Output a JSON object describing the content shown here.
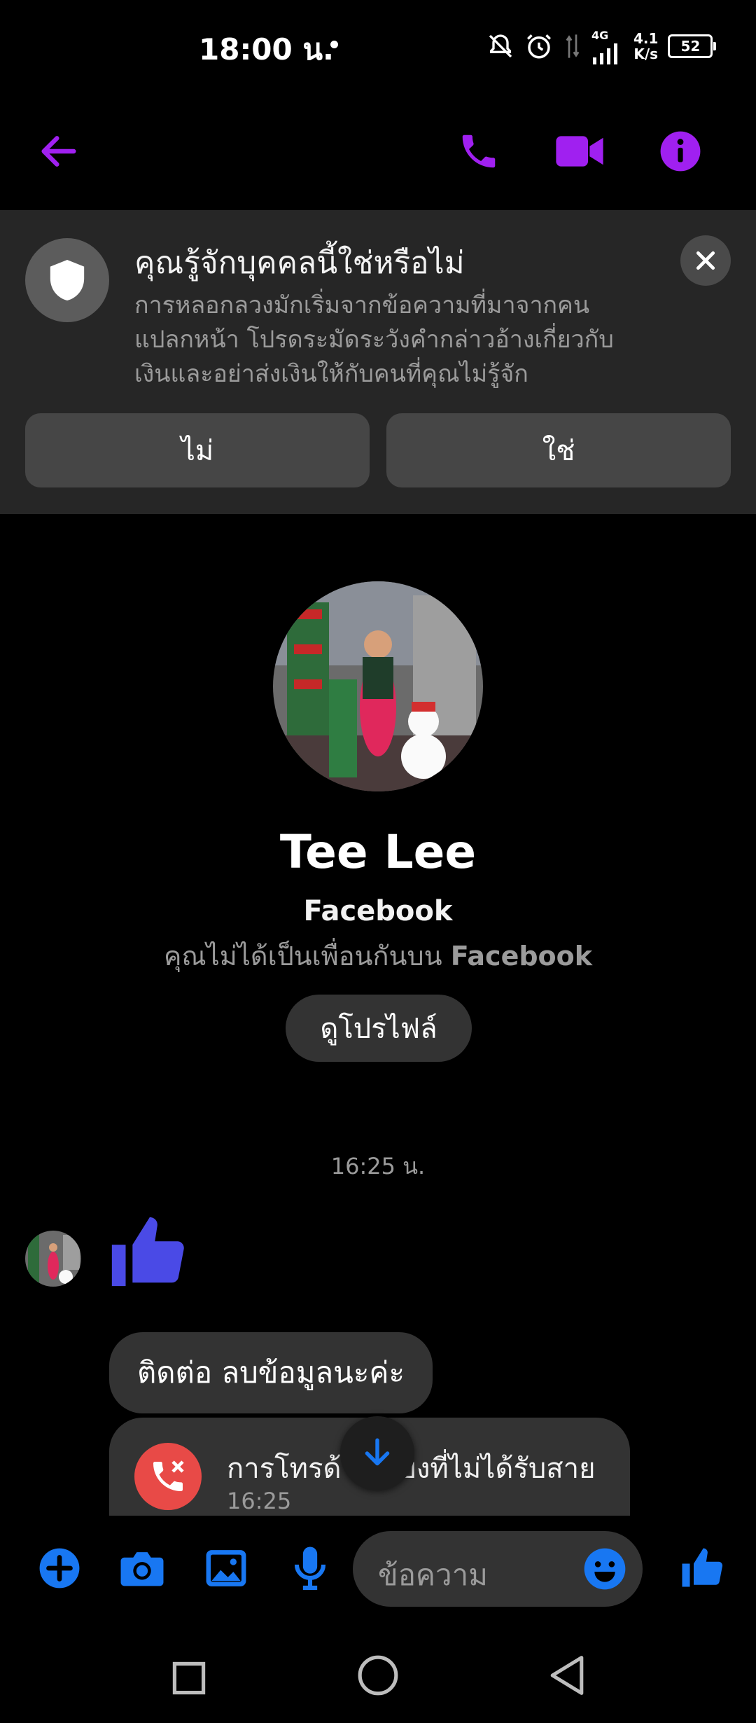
{
  "status_bar": {
    "time": "18:00 น.",
    "network_type": "4G",
    "speed_value": "4.1",
    "speed_unit": "K/s",
    "battery": "52"
  },
  "top_bar": {
    "back_icon": "arrow-left-icon",
    "call_icon": "phone-icon",
    "video_icon": "video-camera-icon",
    "info_icon": "info-icon",
    "accent_color": "#a020f0"
  },
  "warning": {
    "title": "คุณรู้จักบุคคลนี้ใช่หรือไม่",
    "body_line1": "การหลอกลวงมักเริ่มจากข้อความที่มาจากคน",
    "body_line2": "แปลกหน้า โปรดระมัดระวังคำกล่าวอ้างเกี่ยวกับ",
    "body_line3": "เงินและอย่าส่งเงินให้กับคนที่คุณไม่รู้จัก",
    "no_label": "ไม่",
    "yes_label": "ใช่"
  },
  "profile": {
    "name": "Tee Lee",
    "platform": "Facebook",
    "relation_prefix": "คุณไม่ได้เป็นเพื่อนกันบน",
    "relation_platform": "Facebook",
    "view_profile_label": "ดูโปรไฟล์"
  },
  "conversation": {
    "timestamp": "16:25 น.",
    "message_text": "ติดต่อ ลบข้อมูลนะค่ะ",
    "missed_call_text": "การโทรด้วยเสียงที่ไม่ได้รับสาย",
    "missed_call_time": "16:25",
    "like_color": "#4a4ae6"
  },
  "composer": {
    "placeholder": "ข้อความ",
    "icon_color": "#1877f2"
  }
}
